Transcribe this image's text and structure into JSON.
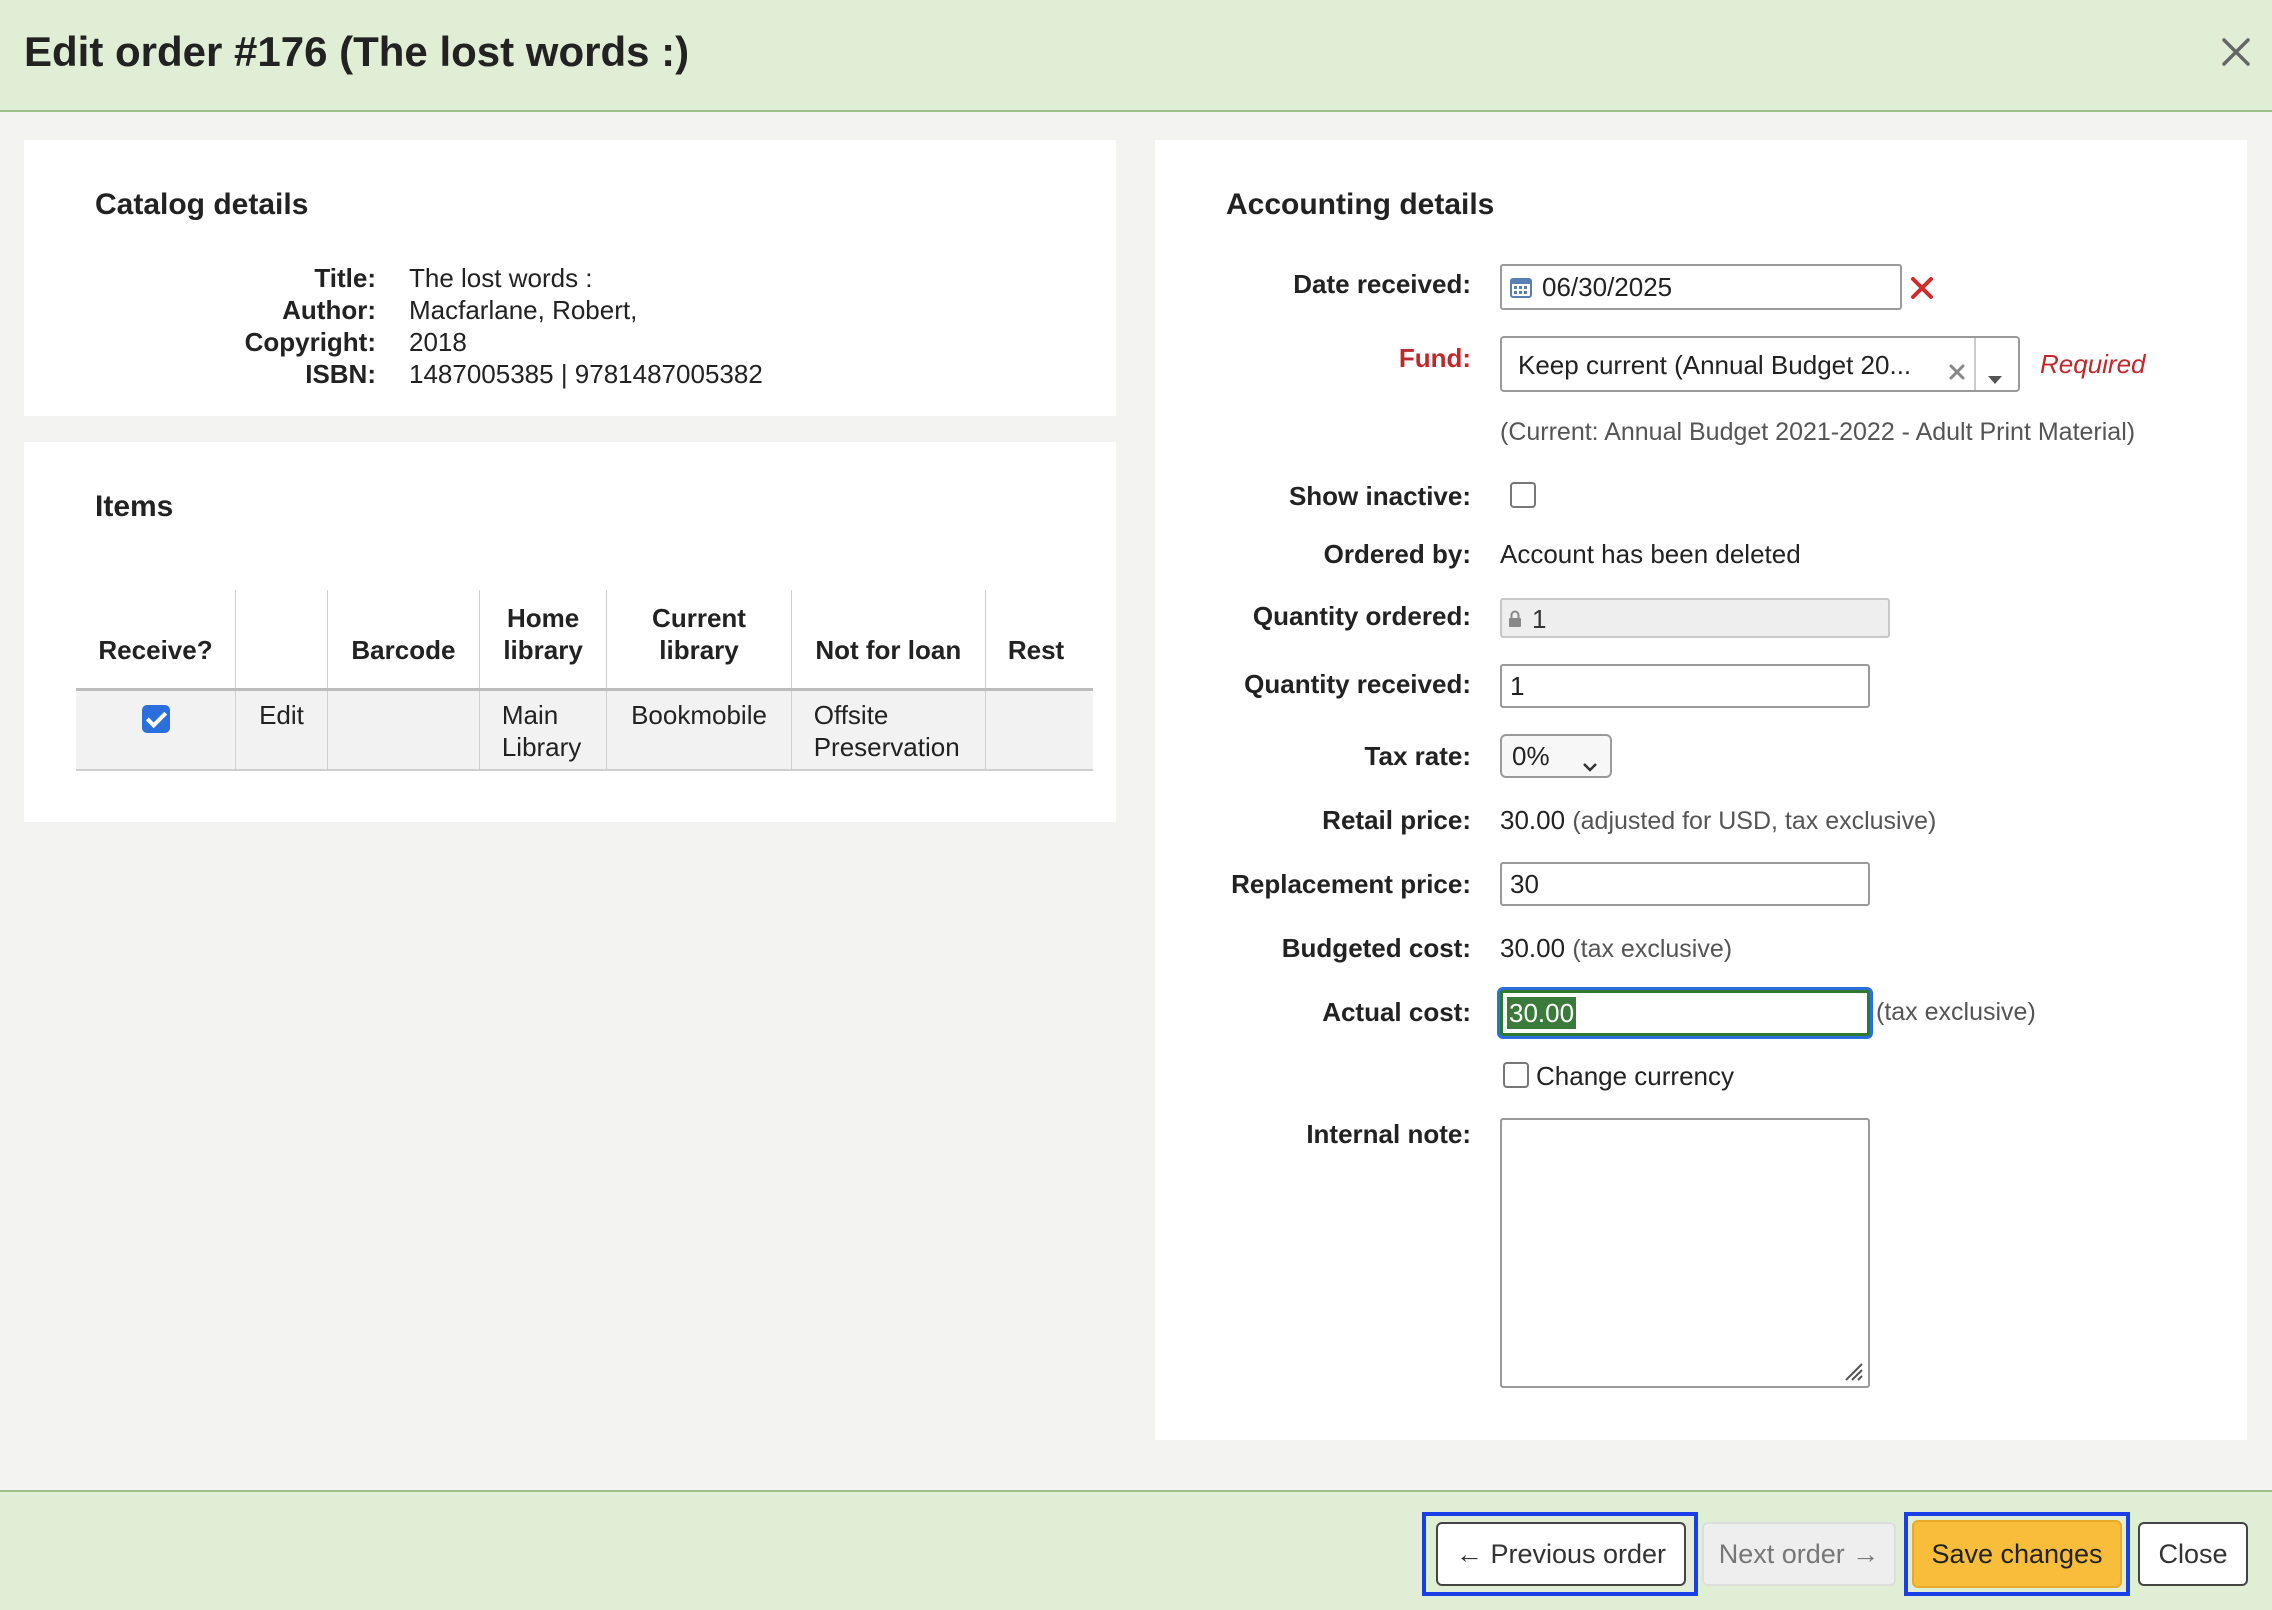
{
  "header": {
    "title": "Edit order #176 (The lost words :)"
  },
  "catalog": {
    "heading": "Catalog details",
    "rows": [
      {
        "label": "Title:",
        "value": "The lost words :"
      },
      {
        "label": "Author:",
        "value": "Macfarlane, Robert,"
      },
      {
        "label": "Copyright:",
        "value": "2018"
      },
      {
        "label": "ISBN:",
        "value": "1487005385 | 9781487005382"
      }
    ]
  },
  "items": {
    "heading": "Items",
    "columns": [
      "Receive?",
      "",
      "Barcode",
      "Home library",
      "Current library",
      "Not for loan",
      "Rest"
    ],
    "rows": [
      {
        "receive": true,
        "action": "Edit",
        "barcode": "",
        "home_library": "Main Library",
        "current_library": "Bookmobile",
        "not_for_loan": "Offsite Preservation",
        "rest": ""
      }
    ]
  },
  "accounting": {
    "heading": "Accounting details",
    "date_received": {
      "label": "Date received:",
      "value": "06/30/2025"
    },
    "fund": {
      "label": "Fund:",
      "selected": "Keep current (Annual Budget 20...",
      "required": "Required",
      "current_note": "(Current: Annual Budget 2021-2022 - Adult Print Material)"
    },
    "show_inactive": {
      "label": "Show inactive:"
    },
    "ordered_by": {
      "label": "Ordered by:",
      "value": "Account has been deleted"
    },
    "quantity_ordered": {
      "label": "Quantity ordered:",
      "value": "1"
    },
    "quantity_received": {
      "label": "Quantity received:",
      "value": "1"
    },
    "tax_rate": {
      "label": "Tax rate:",
      "value": "0%"
    },
    "retail_price": {
      "label": "Retail price:",
      "value": "30.00",
      "note": "(adjusted for USD, tax exclusive)"
    },
    "replacement_price": {
      "label": "Replacement price:",
      "value": "30"
    },
    "budgeted_cost": {
      "label": "Budgeted cost:",
      "value": "30.00",
      "note": "(tax exclusive)"
    },
    "actual_cost": {
      "label": "Actual cost:",
      "value": "30.00",
      "note": "(tax exclusive)"
    },
    "change_currency": {
      "label": "Change currency"
    },
    "internal_note": {
      "label": "Internal note:",
      "value": ""
    }
  },
  "footer": {
    "previous": "Previous order",
    "next": "Next order",
    "save": "Save changes",
    "close": "Close"
  },
  "colors": {
    "header_bg": "#e0eed6",
    "save_bg": "#f7bd3b",
    "focus": "#1a3ee8",
    "required": "#c0282b",
    "checkbox": "#2a6fdb"
  }
}
